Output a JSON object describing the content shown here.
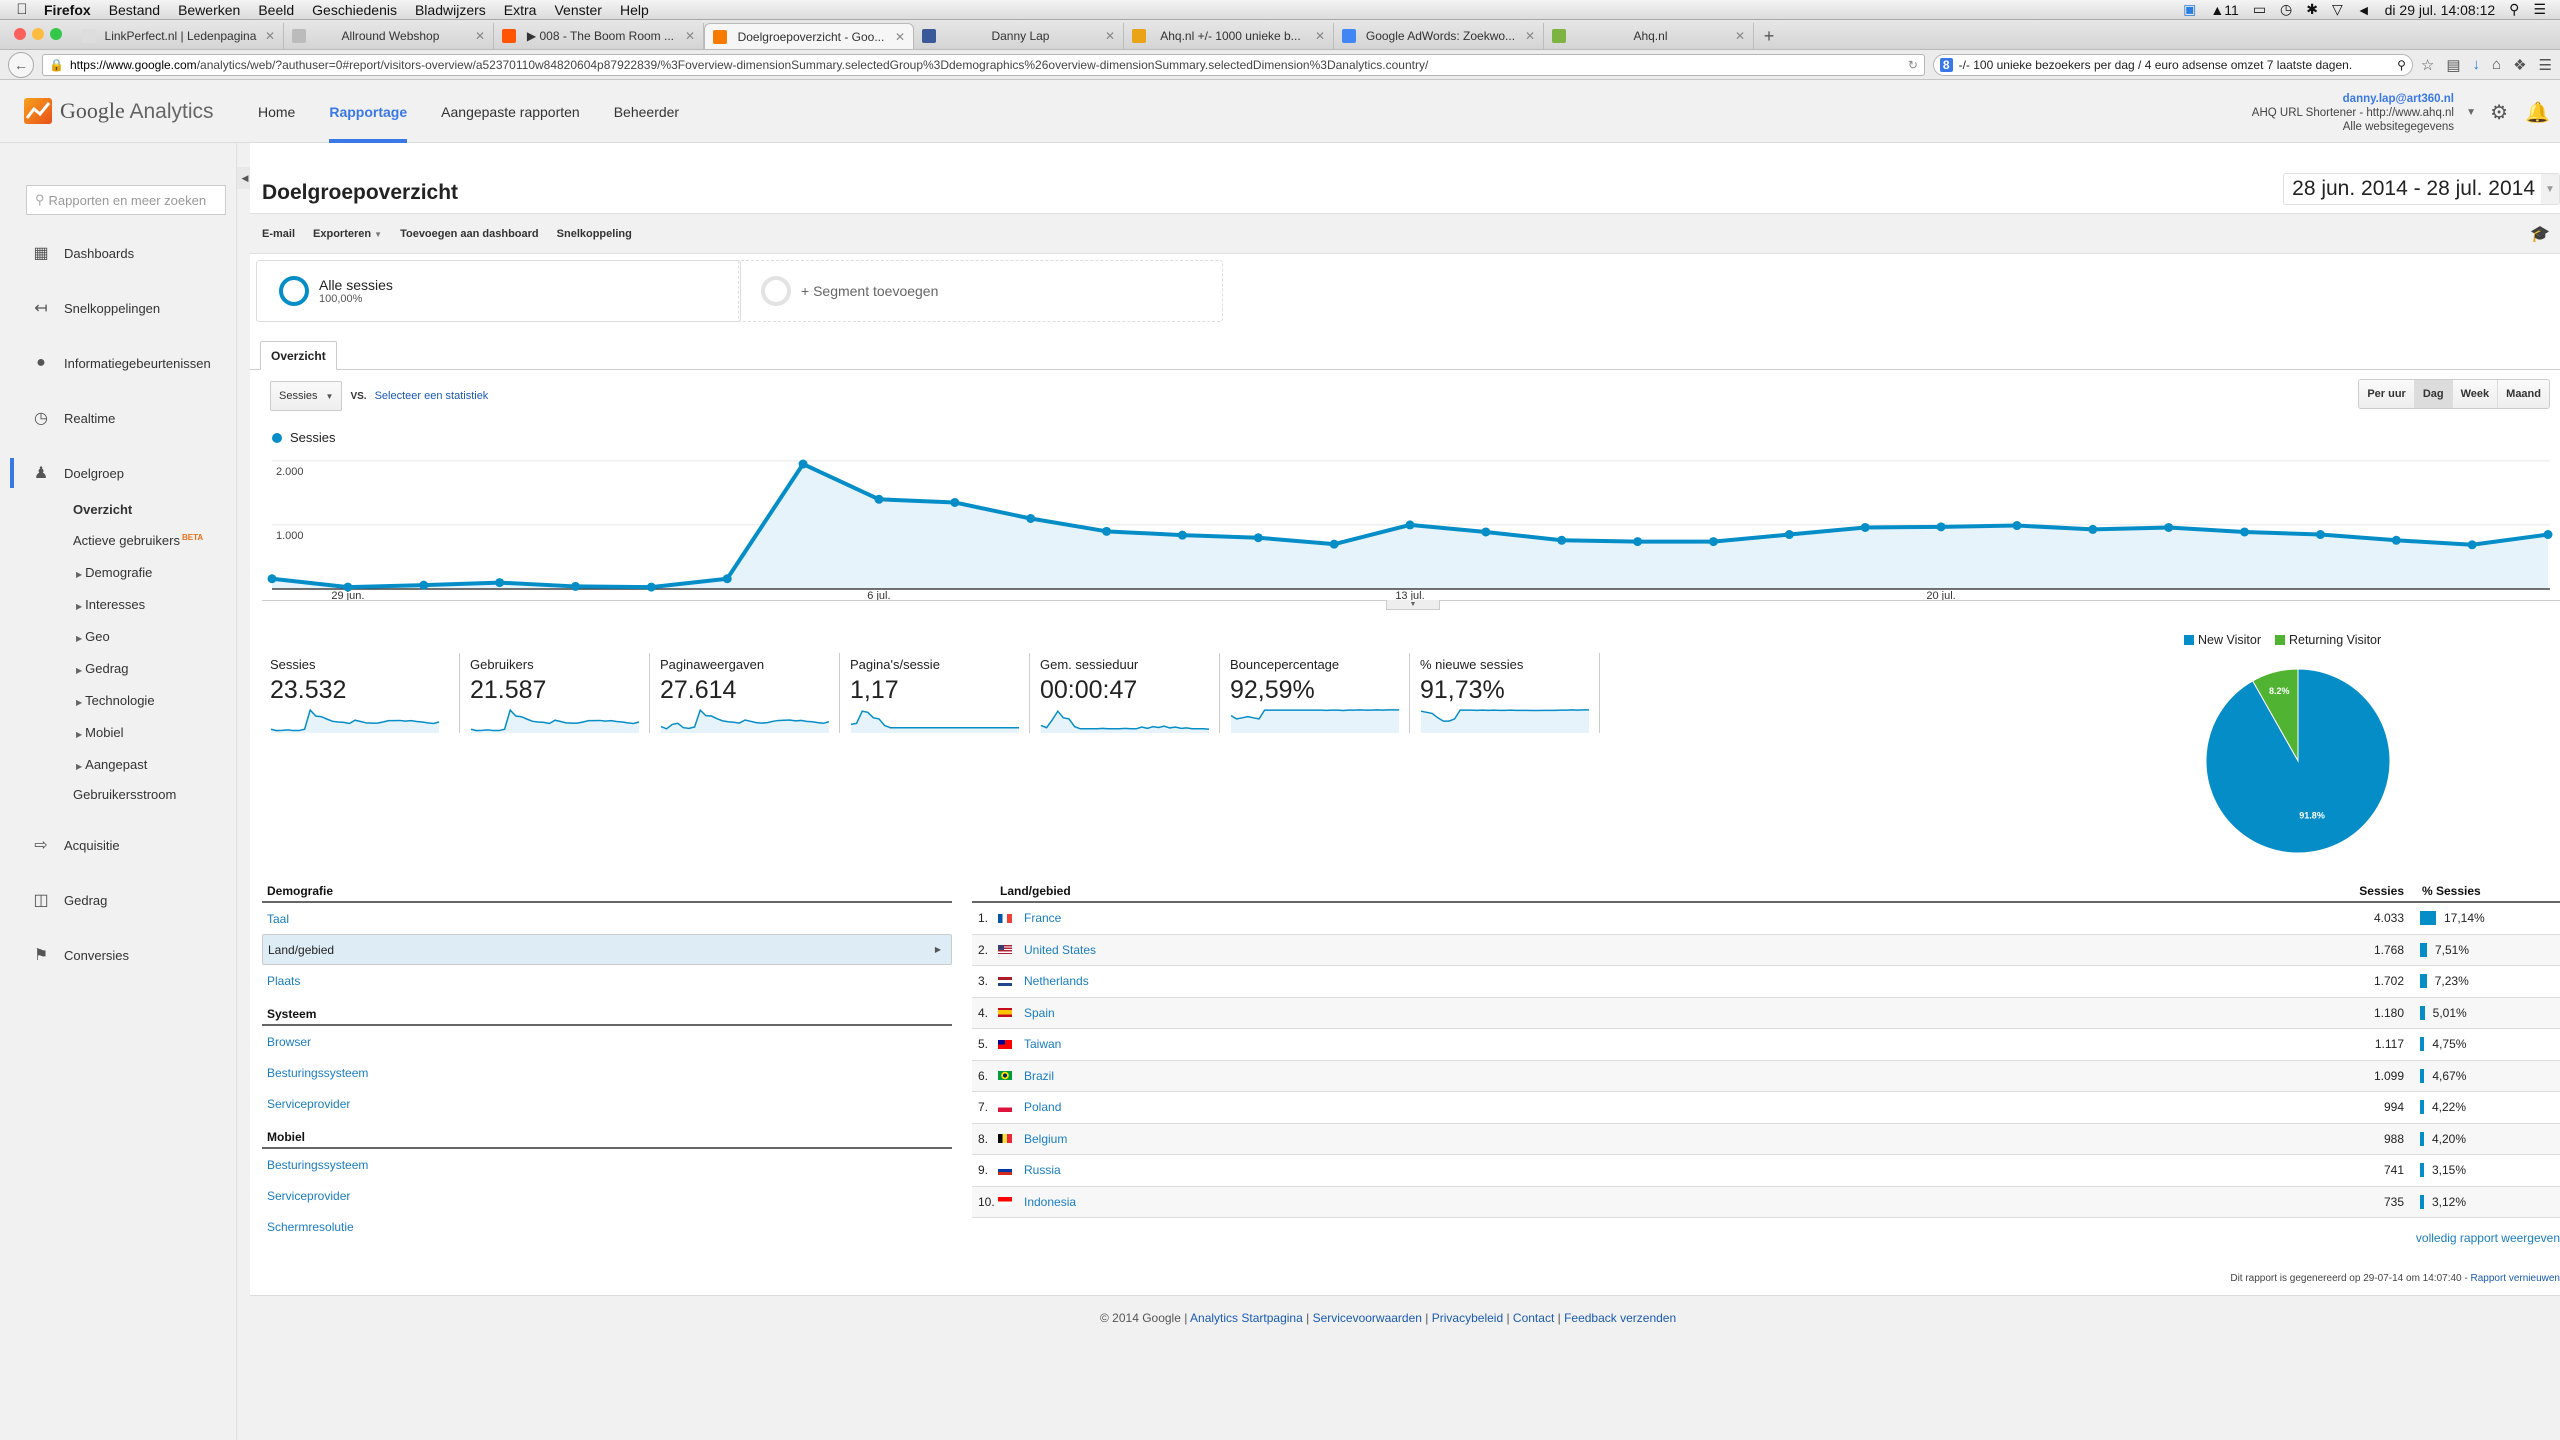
{
  "os_menubar": {
    "app": "Firefox",
    "items": [
      "Bestand",
      "Bewerken",
      "Beeld",
      "Geschiedenis",
      "Bladwijzers",
      "Extra",
      "Venster",
      "Help"
    ],
    "status_count": "11",
    "clock": "di 29 jul.  14:08:12"
  },
  "browser": {
    "tabs": [
      {
        "title": "LinkPerfect.nl | Ledenpagina",
        "fav_color": "#dddddd",
        "active": false
      },
      {
        "title": "Allround Webshop",
        "fav_color": "#bbbbbb",
        "active": false
      },
      {
        "title": "▶ 008 - The Boom Room ...",
        "fav_color": "#ff5500",
        "active": false
      },
      {
        "title": "Doelgroepoverzicht - Goo...",
        "fav_color": "#f57c00",
        "active": true
      },
      {
        "title": "Danny Lap",
        "fav_color": "#3b5998",
        "active": false
      },
      {
        "title": "Ahq.nl +/- 1000 unieke b...",
        "fav_color": "#e8a317",
        "active": false
      },
      {
        "title": "Google AdWords: Zoekwo...",
        "fav_color": "#4285f4",
        "active": false
      },
      {
        "title": "Ahq.nl",
        "fav_color": "#7cb342",
        "active": false
      }
    ],
    "url_host": "https://www.google.com",
    "url_path": "/analytics/web/?authuser=0#report/visitors-overview/a52370110w84820604p87922839/%3Foverview-dimensionSummary.selectedGroup%3Ddemographics%26overview-dimensionSummary.selectedDimension%3Danalytics.country/",
    "search_value": "-/- 100 unieke bezoekers per dag / 4 euro adsense omzet 7 laatste dagen."
  },
  "ga_header": {
    "logo_google": "Google",
    "logo_product": "Analytics",
    "nav": [
      {
        "label": "Home",
        "active": false
      },
      {
        "label": "Rapportage",
        "active": true
      },
      {
        "label": "Aangepaste rapporten",
        "active": false
      },
      {
        "label": "Beheerder",
        "active": false
      }
    ],
    "account_email": "danny.lap@art360.nl",
    "account_property": "AHQ URL Shortener - http://www.ahq.nl",
    "account_view": "Alle websitegegevens"
  },
  "sidebar": {
    "search_placeholder": "Rapporten en meer zoeken",
    "sections": [
      {
        "label": "Dashboards",
        "icon": "grid-icon"
      },
      {
        "label": "Snelkoppelingen",
        "icon": "shortcut-arrow-icon"
      },
      {
        "label": "Informatiegebeurtenissen",
        "icon": "lightbulb-icon"
      },
      {
        "label": "Realtime",
        "icon": "clock-icon"
      },
      {
        "label": "Doelgroep",
        "icon": "people-icon"
      },
      {
        "label": "Acquisitie",
        "icon": "acquisition-arrows-icon"
      },
      {
        "label": "Gedrag",
        "icon": "layout-icon"
      },
      {
        "label": "Conversies",
        "icon": "flag-icon"
      }
    ],
    "audience_sub": {
      "overview": "Overzicht",
      "active_users": "Actieve gebruikers",
      "beta": "BETA",
      "expandables": [
        "Demografie",
        "Interesses",
        "Geo",
        "Gedrag",
        "Technologie",
        "Mobiel",
        "Aangepast"
      ],
      "flow": "Gebruikersstroom"
    }
  },
  "report": {
    "title": "Doelgroepoverzicht",
    "date_range": "28 jun. 2014 - 28 jul. 2014",
    "actions": [
      "E-mail",
      "Exporteren",
      "Toevoegen aan dashboard",
      "Snelkoppeling"
    ],
    "segments": {
      "all_label": "Alle sessies",
      "all_pct": "100,00%",
      "add_label": "+ Segment toevoegen"
    },
    "tab": "Overzicht",
    "metric_select": "Sessies",
    "vs": "VS.",
    "select_stat": "Selecteer een statistiek",
    "granularity": [
      {
        "label": "Per uur",
        "active": false
      },
      {
        "label": "Dag",
        "active": true
      },
      {
        "label": "Week",
        "active": false
      },
      {
        "label": "Maand",
        "active": false
      }
    ],
    "legend": "Sessies",
    "colors": {
      "primary": "#058dc7",
      "fill": "#e6f3fa",
      "returning": "#50b432"
    }
  },
  "chart_data": [
    {
      "type": "area",
      "title": "Sessies",
      "xlabel": "",
      "ylabel": "",
      "ylim": [
        0,
        2200
      ],
      "yticks": [
        {
          "value": 1000,
          "label": "1.000"
        },
        {
          "value": 2000,
          "label": "2.000"
        }
      ],
      "xticks": [
        {
          "index": 1,
          "label": "29 jun."
        },
        {
          "index": 8,
          "label": "6 jul."
        },
        {
          "index": 15,
          "label": "13 jul."
        },
        {
          "index": 22,
          "label": "20 jul."
        }
      ],
      "x": [
        "28 jun",
        "29 jun",
        "30 jun",
        "1 jul",
        "2 jul",
        "3 jul",
        "4 jul",
        "5 jul",
        "6 jul",
        "7 jul",
        "8 jul",
        "9 jul",
        "10 jul",
        "11 jul",
        "12 jul",
        "13 jul",
        "14 jul",
        "15 jul",
        "16 jul",
        "17 jul",
        "18 jul",
        "19 jul",
        "20 jul",
        "21 jul",
        "22 jul",
        "23 jul",
        "24 jul",
        "25 jul",
        "26 jul",
        "27 jul",
        "28 jul"
      ],
      "series": [
        {
          "name": "Sessies",
          "values": [
            160,
            30,
            60,
            100,
            40,
            30,
            160,
            1950,
            1400,
            1350,
            1100,
            900,
            840,
            800,
            700,
            1000,
            890,
            760,
            740,
            740,
            850,
            960,
            970,
            990,
            930,
            960,
            890,
            850,
            760,
            690,
            850
          ]
        }
      ],
      "grid": true,
      "legend": "top-left"
    },
    {
      "type": "pie",
      "legend": "top",
      "slices": [
        {
          "label": "New Visitor",
          "value": 91.8,
          "display": "91.8%",
          "color": "#058dc7"
        },
        {
          "label": "Returning Visitor",
          "value": 8.2,
          "display": "8.2%",
          "color": "#50b432"
        }
      ]
    }
  ],
  "metrics": [
    {
      "label": "Sessies",
      "value": "23.532",
      "spark": [
        8,
        2,
        3,
        5,
        2,
        2,
        8,
        95,
        68,
        65,
        54,
        44,
        41,
        39,
        34,
        49,
        43,
        37,
        36,
        36,
        41,
        47,
        47,
        48,
        45,
        47,
        43,
        41,
        37,
        34,
        41
      ]
    },
    {
      "label": "Gebruikers",
      "value": "21.587",
      "spark": [
        8,
        2,
        3,
        5,
        2,
        2,
        8,
        95,
        68,
        65,
        54,
        44,
        41,
        39,
        34,
        49,
        43,
        37,
        36,
        36,
        41,
        47,
        47,
        48,
        45,
        47,
        43,
        41,
        37,
        34,
        41
      ]
    },
    {
      "label": "Paginaweergaven",
      "value": "27.614",
      "spark": [
        20,
        10,
        30,
        35,
        15,
        12,
        18,
        95,
        70,
        68,
        56,
        46,
        42,
        40,
        36,
        50,
        44,
        38,
        36,
        38,
        44,
        48,
        49,
        50,
        46,
        48,
        44,
        42,
        38,
        35,
        42
      ]
    },
    {
      "label": "Pagina's/sessie",
      "value": "1,17",
      "spark": [
        30,
        35,
        90,
        85,
        60,
        55,
        25,
        15,
        15,
        15,
        15,
        15,
        15,
        15,
        15,
        15,
        15,
        15,
        15,
        15,
        15,
        15,
        15,
        15,
        15,
        15,
        15,
        15,
        15,
        15,
        15
      ]
    },
    {
      "label": "Gem. sessieduur",
      "value": "00:00:47",
      "spark": [
        25,
        15,
        50,
        90,
        60,
        55,
        20,
        10,
        10,
        10,
        10,
        12,
        10,
        10,
        10,
        12,
        10,
        10,
        18,
        12,
        20,
        16,
        22,
        14,
        18,
        12,
        14,
        10,
        10,
        10,
        8
      ]
    },
    {
      "label": "Bouncepercentage",
      "value": "92,59%",
      "spark": [
        70,
        55,
        60,
        65,
        60,
        55,
        95,
        95,
        95,
        95,
        95,
        95,
        95,
        95,
        95,
        95,
        95,
        94,
        95,
        95,
        93,
        95,
        95,
        96,
        95,
        95,
        96,
        95,
        96,
        96,
        96
      ]
    },
    {
      "label": "% nieuwe sessies",
      "value": "91,73%",
      "spark": [
        90,
        85,
        80,
        60,
        45,
        45,
        55,
        95,
        95,
        95,
        94,
        95,
        94,
        95,
        94,
        94,
        95,
        94,
        94,
        94,
        93,
        93,
        94,
        94,
        94,
        95,
        95,
        96,
        95,
        96,
        96
      ]
    }
  ],
  "dimensions": {
    "groups": [
      {
        "heading": "Demografie",
        "items": [
          {
            "label": "Taal",
            "selected": false
          },
          {
            "label": "Land/gebied",
            "selected": true
          },
          {
            "label": "Plaats",
            "selected": false
          }
        ]
      },
      {
        "heading": "Systeem",
        "items": [
          {
            "label": "Browser",
            "selected": false
          },
          {
            "label": "Besturingssysteem",
            "selected": false
          },
          {
            "label": "Serviceprovider",
            "selected": false
          }
        ]
      },
      {
        "heading": "Mobiel",
        "items": [
          {
            "label": "Besturingssysteem",
            "selected": false
          },
          {
            "label": "Serviceprovider",
            "selected": false
          },
          {
            "label": "Schermresolutie",
            "selected": false
          }
        ]
      }
    ]
  },
  "country_table": {
    "headers": {
      "country": "Land/gebied",
      "sessions": "Sessies",
      "pct": "% Sessies"
    },
    "rows": [
      {
        "rank": "1.",
        "country": "France",
        "sessions": "4.033",
        "pct": "17,14%",
        "pct_value": 17.14,
        "flag": [
          "#0055a4",
          "#ffffff",
          "#ef4135"
        ],
        "flag_dir": "v"
      },
      {
        "rank": "2.",
        "country": "United States",
        "sessions": "1.768",
        "pct": "7,51%",
        "pct_value": 7.51,
        "flag": [
          "#b22234",
          "#ffffff",
          "#3c3b6e"
        ],
        "flag_dir": "us"
      },
      {
        "rank": "3.",
        "country": "Netherlands",
        "sessions": "1.702",
        "pct": "7,23%",
        "pct_value": 7.23,
        "flag": [
          "#ae1c28",
          "#ffffff",
          "#21468b"
        ],
        "flag_dir": "h"
      },
      {
        "rank": "4.",
        "country": "Spain",
        "sessions": "1.180",
        "pct": "5,01%",
        "pct_value": 5.01,
        "flag": [
          "#c60b1e",
          "#ffc400",
          "#c60b1e"
        ],
        "flag_dir": "es"
      },
      {
        "rank": "5.",
        "country": "Taiwan",
        "sessions": "1.117",
        "pct": "4,75%",
        "pct_value": 4.75,
        "flag": [
          "#fe0000",
          "#000095"
        ],
        "flag_dir": "tw"
      },
      {
        "rank": "6.",
        "country": "Brazil",
        "sessions": "1.099",
        "pct": "4,67%",
        "pct_value": 4.67,
        "flag": [
          "#009c3b",
          "#ffdf00",
          "#002776"
        ],
        "flag_dir": "br"
      },
      {
        "rank": "7.",
        "country": "Poland",
        "sessions": "994",
        "pct": "4,22%",
        "pct_value": 4.22,
        "flag": [
          "#ffffff",
          "#dc143c"
        ],
        "flag_dir": "h2"
      },
      {
        "rank": "8.",
        "country": "Belgium",
        "sessions": "988",
        "pct": "4,20%",
        "pct_value": 4.2,
        "flag": [
          "#000000",
          "#fae042",
          "#ed2939"
        ],
        "flag_dir": "v"
      },
      {
        "rank": "9.",
        "country": "Russia",
        "sessions": "741",
        "pct": "3,15%",
        "pct_value": 3.15,
        "flag": [
          "#ffffff",
          "#0039a6",
          "#d52b1e"
        ],
        "flag_dir": "h"
      },
      {
        "rank": "10.",
        "country": "Indonesia",
        "sessions": "735",
        "pct": "3,12%",
        "pct_value": 3.12,
        "flag": [
          "#ff0000",
          "#ffffff"
        ],
        "flag_dir": "h2"
      }
    ],
    "full_report": "volledig rapport weergeven"
  },
  "generated": {
    "text": "Dit rapport is gegenereerd op 29-07-14 om 14:07:40 - ",
    "refresh": "Rapport vernieuwen"
  },
  "footer": {
    "copyright": "© 2014 Google",
    "links": [
      "Analytics Startpagina",
      "Servicevoorwaarden",
      "Privacybeleid",
      "Contact",
      "Feedback verzenden"
    ]
  }
}
